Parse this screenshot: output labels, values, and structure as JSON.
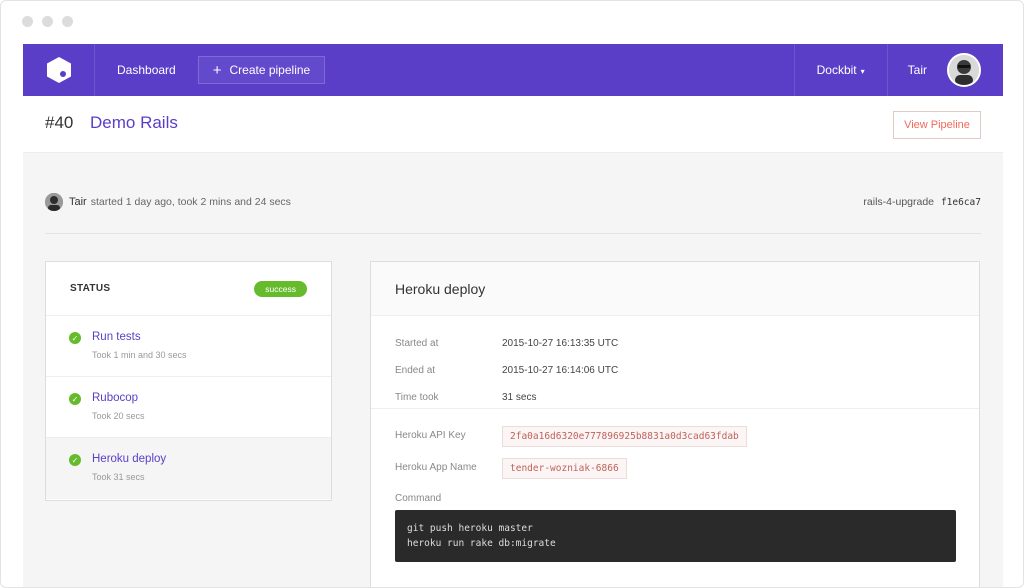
{
  "nav": {
    "dashboard": "Dashboard",
    "create_pipeline": "Create pipeline",
    "team": "Dockbit",
    "user": "Tair"
  },
  "header": {
    "build_number": "#40",
    "build_name": "Demo Rails",
    "view_pipeline": "View Pipeline"
  },
  "meta": {
    "user": "Tair",
    "text": "started 1 day ago, took 2 mins and 24 secs",
    "branch": "rails-4-upgrade",
    "sha": "f1e6ca7"
  },
  "status": {
    "title": "STATUS",
    "badge": "success",
    "jobs": [
      {
        "name": "Run tests",
        "time": "Took 1 min and 30 secs"
      },
      {
        "name": "Rubocop",
        "time": "Took 20 secs"
      },
      {
        "name": "Heroku deploy",
        "time": "Took 31 secs"
      }
    ]
  },
  "detail": {
    "title": "Heroku deploy",
    "started_label": "Started at",
    "started_value": "2015-10-27 16:13:35 UTC",
    "ended_label": "Ended at",
    "ended_value": "2015-10-27 16:14:06 UTC",
    "took_label": "Time took",
    "took_value": "31 secs",
    "api_key_label": "Heroku API Key",
    "api_key_value": "2fa0a16d6320e777896925b8831a0d3cad63fdab",
    "app_name_label": "Heroku App Name",
    "app_name_value": "tender-wozniak-6866",
    "command_label": "Command",
    "command_lines": [
      "git push heroku master",
      "heroku run rake db:migrate"
    ]
  },
  "colors": {
    "brand": "#5a3ec8",
    "success": "#66bb2d",
    "accent": "#ef6b5b"
  }
}
